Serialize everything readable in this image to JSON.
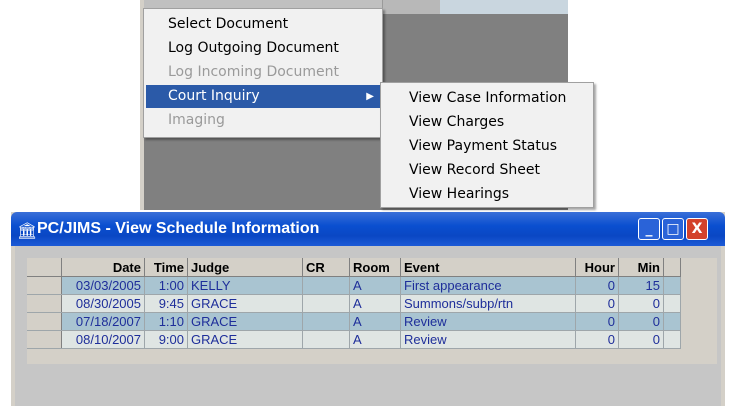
{
  "main_menu": {
    "items": [
      {
        "label": "Select Document",
        "enabled": true
      },
      {
        "label": "Log Outgoing Document",
        "enabled": true
      },
      {
        "label": "Log Incoming Document",
        "enabled": false
      },
      {
        "label": "Court Inquiry",
        "enabled": true,
        "highlighted": true,
        "submenu_arrow": "▶"
      },
      {
        "label": "Imaging",
        "enabled": false
      }
    ]
  },
  "court_inquiry_menu": {
    "items": [
      {
        "label": "View Case Information"
      },
      {
        "label": "View Charges"
      },
      {
        "label": "View Payment Status"
      },
      {
        "label": "View Record Sheet"
      },
      {
        "label": "View Hearings"
      }
    ]
  },
  "window": {
    "title": "PC/JIMS - View Schedule Information",
    "icon": "courthouse-icon",
    "buttons": {
      "minimize": "_",
      "maximize": "□",
      "close": "X"
    },
    "colors": {
      "title_bar": "#0a4fd0",
      "close_button": "#d3422b",
      "row_odd": "#a9c4d1",
      "row_even": "#dfe5e3",
      "cell_text": "#1e2e9a"
    }
  },
  "schedule_table": {
    "columns": [
      "Date",
      "Time",
      "Judge",
      "CR",
      "Room",
      "Event",
      "Hour",
      "Min"
    ],
    "rows": [
      {
        "date": "03/03/2005",
        "time": "1:00",
        "judge": "KELLY",
        "cr": "",
        "room": "A",
        "event": "First appearance",
        "hour": "0",
        "min": "15"
      },
      {
        "date": "08/30/2005",
        "time": "9:45",
        "judge": "GRACE",
        "cr": "",
        "room": "A",
        "event": "Summons/subp/rtn",
        "hour": "0",
        "min": "0"
      },
      {
        "date": "07/18/2007",
        "time": "1:10",
        "judge": "GRACE",
        "cr": "",
        "room": "A",
        "event": "Review",
        "hour": "0",
        "min": "0"
      },
      {
        "date": "08/10/2007",
        "time": "9:00",
        "judge": "GRACE",
        "cr": "",
        "room": "A",
        "event": "Review",
        "hour": "0",
        "min": "0"
      }
    ]
  }
}
